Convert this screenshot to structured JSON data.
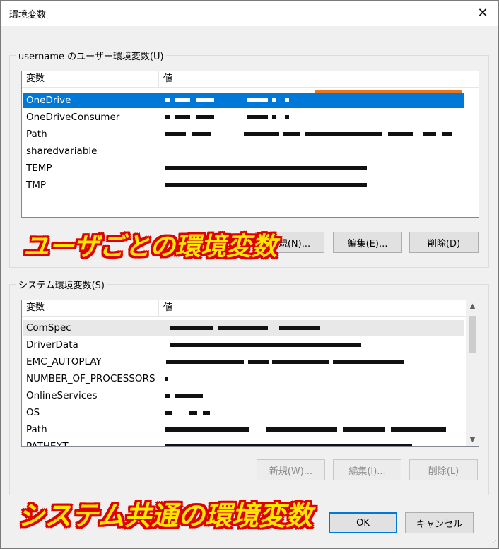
{
  "window": {
    "title": "環境変数"
  },
  "user_group": {
    "label": "username のユーザー環境変数(U)",
    "columns": [
      "変数",
      "値"
    ],
    "rows": [
      {
        "name": "OneDrive",
        "selected": true
      },
      {
        "name": "OneDriveConsumer"
      },
      {
        "name": "Path"
      },
      {
        "name": "sharedvariable"
      },
      {
        "name": "TEMP"
      },
      {
        "name": "TMP"
      }
    ],
    "buttons": {
      "new": "新規(N)...",
      "edit": "編集(E)...",
      "delete": "削除(D)"
    }
  },
  "system_group": {
    "label": "システム環境変数(S)",
    "columns": [
      "変数",
      "値"
    ],
    "rows": [
      {
        "name": "ComSpec"
      },
      {
        "name": "DriverData"
      },
      {
        "name": "EMC_AUTOPLAY"
      },
      {
        "name": "NUMBER_OF_PROCESSORS"
      },
      {
        "name": "OnlineServices"
      },
      {
        "name": "OS"
      },
      {
        "name": "Path"
      },
      {
        "name": "PATHEXT"
      }
    ],
    "buttons": {
      "new": "新規(W)...",
      "edit": "編集(I)...",
      "delete": "削除(L)"
    }
  },
  "footer": {
    "ok": "OK",
    "cancel": "キャンセル"
  },
  "annotations": {
    "user_banner": "ユーザごとの環境変数",
    "system_banner": "システム共通の環境変数"
  },
  "icons": {
    "close": "close-icon",
    "scroll_up": "chevron-up-icon",
    "scroll_down": "chevron-down-icon"
  },
  "colors": {
    "selection": "#0078d7",
    "banner_text": "#ffe800",
    "banner_outline": "#e00000",
    "highlight_line": "#e87722"
  }
}
